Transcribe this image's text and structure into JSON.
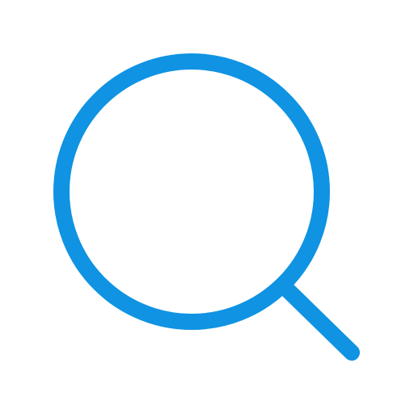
{
  "icon": {
    "name": "search-icon",
    "color": "#0f93e2",
    "background": "#ffffff"
  }
}
